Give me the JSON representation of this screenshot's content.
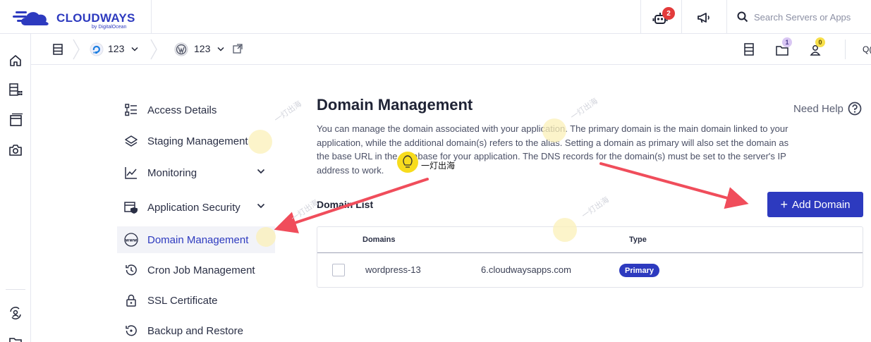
{
  "brand": {
    "name": "CLOUDWAYS",
    "sub": "by DigitalOcean",
    "color": "#2d3abf"
  },
  "topbar": {
    "bot_badge": "2",
    "search_placeholder": "Search Servers or Apps"
  },
  "subbar": {
    "server_name": "123",
    "app_name": "123",
    "badge_folder": "1",
    "badge_user": "0",
    "truncated_right": "Q("
  },
  "sidenav": {
    "items": [
      {
        "label": "Access Details",
        "icon": "access-details-icon"
      },
      {
        "label": "Staging Management",
        "icon": "layers-icon"
      },
      {
        "label": "Monitoring",
        "icon": "chart-icon",
        "has_chevron": true
      },
      {
        "label": "Application Security",
        "icon": "shield-window-icon",
        "has_chevron": true
      },
      {
        "label": "Domain Management",
        "icon": "www-icon",
        "active": true
      },
      {
        "label": "Cron Job Management",
        "icon": "history-icon"
      },
      {
        "label": "SSL Certificate",
        "icon": "lock-icon"
      },
      {
        "label": "Backup and Restore",
        "icon": "restore-icon"
      }
    ]
  },
  "main": {
    "title": "Domain Management",
    "need_help": "Need Help",
    "description": "You can manage the domain associated with your application. The primary domain is the main domain linked to your application, while the additional domain(s) refers to the alias. Setting a domain as primary will also set the domain as the base URL in the database for your application. The DNS records for the domain(s) must be set to the server's IP address to work.",
    "list_title": "Domain List",
    "add_button": "Add Domain",
    "table": {
      "columns": [
        "Domains",
        "Type"
      ],
      "rows": [
        {
          "domain_part1": "wordpress-13",
          "domain_part2": "6.cloudwaysapps.com",
          "type": "Primary"
        }
      ]
    }
  },
  "watermark": {
    "text": "一灯出海"
  }
}
